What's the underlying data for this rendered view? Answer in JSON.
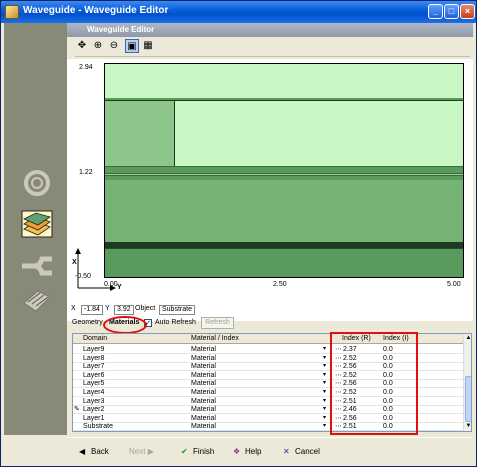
{
  "window": {
    "title": "Waveguide - Waveguide Editor",
    "controls": [
      "_",
      "□",
      "×"
    ]
  },
  "editor": {
    "title": "Waveguide Editor",
    "toolbar": [
      "pointer-tool",
      "zoom-in",
      "zoom-out",
      "fit-view",
      "grid-view"
    ]
  },
  "plot": {
    "y_ticks": [
      "2.94",
      "1.22",
      "-0.50"
    ],
    "x_ticks": [
      "0.00",
      "2.50",
      "5.00"
    ],
    "x_axis_label": "Y",
    "y_axis_label": "X",
    "colors": {
      "background": "#c9f7c3",
      "layer_mid": "#8cc68a",
      "layer_dark": "#5a9a5c",
      "core": "#1e3a22"
    }
  },
  "coords": {
    "x_label": "X",
    "x_value": "-1.84",
    "y_label": "Y",
    "y_value": "3.92",
    "object_label": "Object",
    "object_value": "Substrate"
  },
  "tabs": {
    "geometry": "Geometry",
    "materials": "Materials",
    "auto_refresh": "Auto Refresh",
    "refresh": "Refresh"
  },
  "grid": {
    "headers": {
      "domain": "Domain",
      "material": "Material / Index",
      "index_r": "Index (R)",
      "index_i": "Index (I)"
    },
    "rows": [
      {
        "domain": "Layer9",
        "material": "Material",
        "index_r": "2.37",
        "index_i": "0.0"
      },
      {
        "domain": "Layer8",
        "material": "Material",
        "index_r": "2.52",
        "index_i": "0.0"
      },
      {
        "domain": "Layer7",
        "material": "Material",
        "index_r": "2.56",
        "index_i": "0.0"
      },
      {
        "domain": "Layer6",
        "material": "Material",
        "index_r": "2.52",
        "index_i": "0.0"
      },
      {
        "domain": "Layer5",
        "material": "Material",
        "index_r": "2.56",
        "index_i": "0.0"
      },
      {
        "domain": "Layer4",
        "material": "Material",
        "index_r": "2.52",
        "index_i": "0.0"
      },
      {
        "domain": "Layer3",
        "material": "Material",
        "index_r": "2.51",
        "index_i": "0.0"
      },
      {
        "domain": "Layer2",
        "material": "Material",
        "index_r": "2.46",
        "index_i": "0.0"
      },
      {
        "domain": "Layer1",
        "material": "Material",
        "index_r": "2.56",
        "index_i": "0.0"
      },
      {
        "domain": "Substrate",
        "material": "Material",
        "index_r": "2.51",
        "index_i": "0.0"
      }
    ]
  },
  "footer": {
    "back": "Back",
    "next": "Next",
    "finish": "Finish",
    "help": "Help",
    "cancel": "Cancel"
  }
}
